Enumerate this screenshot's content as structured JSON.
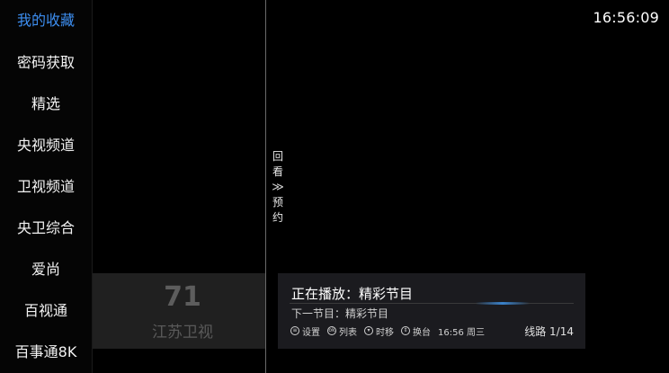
{
  "sidebar": {
    "items": [
      {
        "label": "我的收藏",
        "active": true
      },
      {
        "label": "密码获取",
        "active": false
      },
      {
        "label": "精选",
        "active": false
      },
      {
        "label": "央视频道",
        "active": false
      },
      {
        "label": "卫视频道",
        "active": false
      },
      {
        "label": "央卫综合",
        "active": false
      },
      {
        "label": "爱尚",
        "active": false
      },
      {
        "label": "百视通",
        "active": false
      },
      {
        "label": "百事通8K",
        "active": false
      }
    ]
  },
  "side_toggle": {
    "top": "回看",
    "chevron": "≫",
    "bottom": "预约"
  },
  "clock": "16:56:09",
  "channel": {
    "number": "71",
    "name": "江苏卫视"
  },
  "program": {
    "now_playing": "正在播放：精彩节目",
    "next": "下一节目：精彩节目",
    "progress": 0.75
  },
  "hints": [
    {
      "icon": "menu-icon",
      "label": "设置"
    },
    {
      "icon": "ok-icon",
      "label": "列表"
    },
    {
      "icon": "down-icon",
      "label": "时移"
    },
    {
      "icon": "up-down-icon",
      "label": "换台"
    }
  ],
  "time_day": "16:56 周三",
  "route": "线路 1/14",
  "colors": {
    "accent": "#3d8ef0",
    "background": "#000000"
  }
}
